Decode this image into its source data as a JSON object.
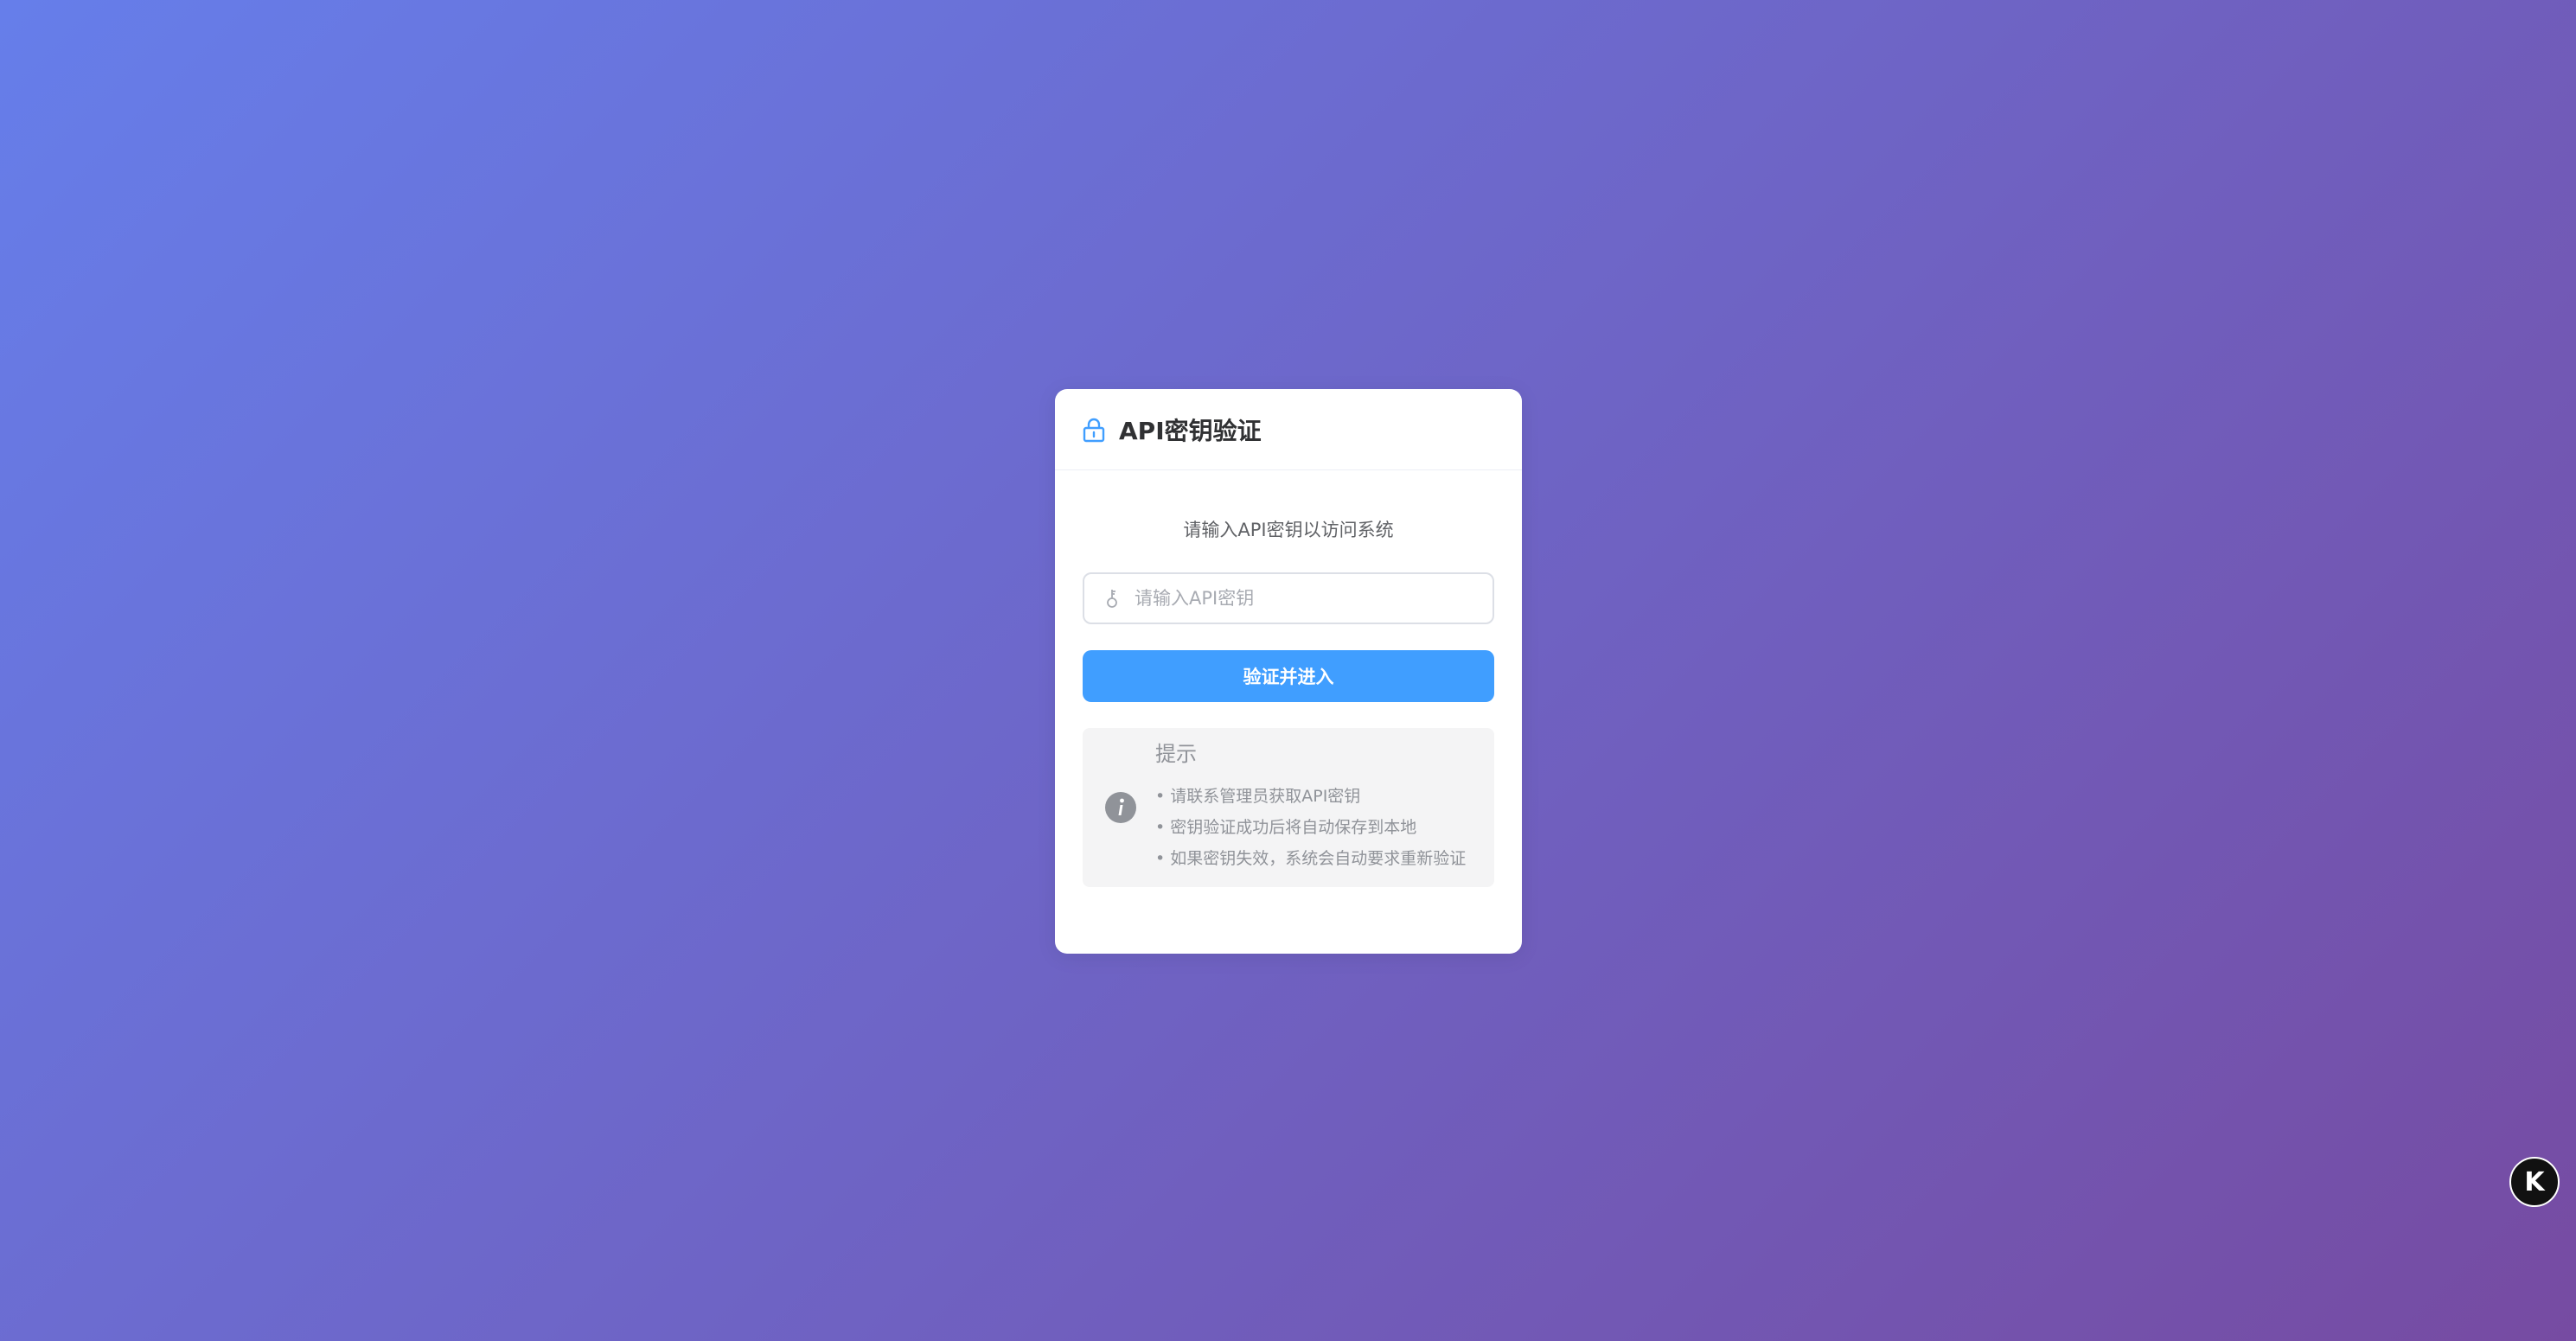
{
  "card": {
    "title": "API密钥验证",
    "subtitle": "请输入API密钥以访问系统"
  },
  "form": {
    "api_key_value": "",
    "api_key_placeholder": "请输入API密钥",
    "submit_label": "验证并进入"
  },
  "tips": {
    "title": "提示",
    "items": [
      "• 请联系管理员获取API密钥",
      "• 密钥验证成功后将自动保存到本地",
      "• 如果密钥失效，系统会自动要求重新验证"
    ]
  },
  "badge": {
    "letter": "K"
  },
  "icons": {
    "lock": "lock-icon",
    "key": "key-icon",
    "info": "info-icon"
  },
  "colors": {
    "gradient_start": "#667eea",
    "gradient_end": "#764ba2",
    "primary": "#409eff",
    "title_text": "#303133",
    "muted_text": "#909399",
    "tips_bg": "#f4f4f5"
  }
}
